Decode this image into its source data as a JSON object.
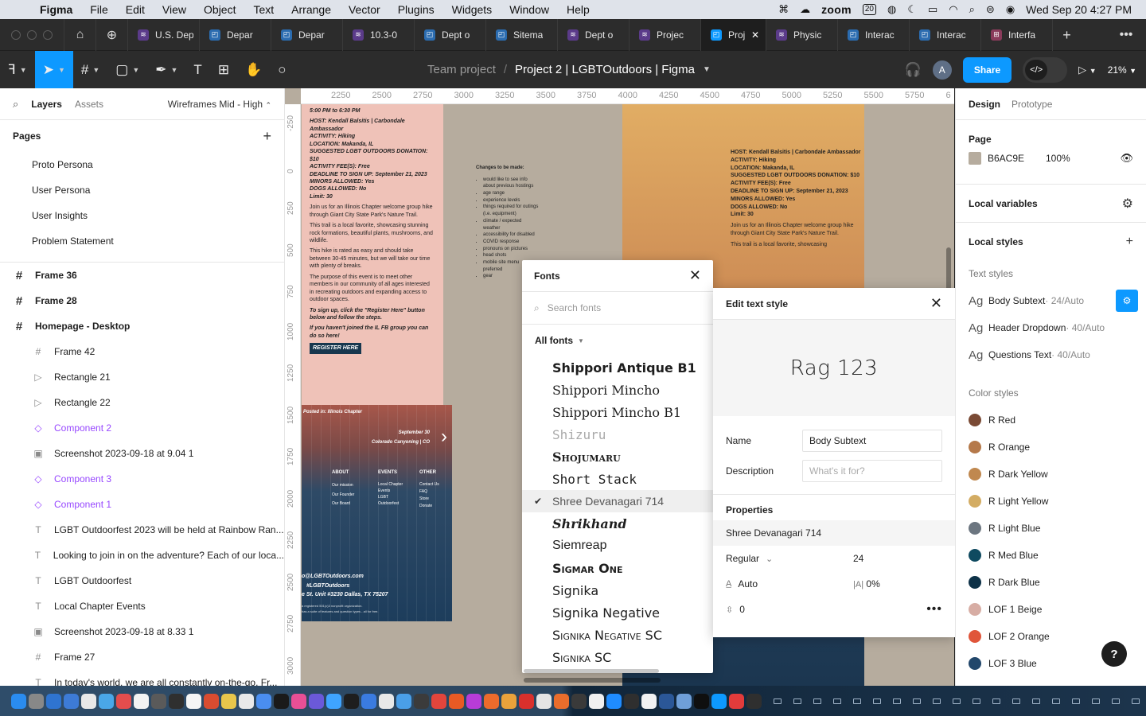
{
  "menubar": {
    "app_name": "Figma",
    "menus": [
      "File",
      "Edit",
      "View",
      "Object",
      "Text",
      "Arrange",
      "Vector",
      "Plugins",
      "Widgets",
      "Window",
      "Help"
    ],
    "zoom_app": "zoom",
    "calendar_day": "20",
    "datetime": "Wed Sep 20  4:27 PM"
  },
  "tabs": [
    {
      "label": "U.S. Dep",
      "color": "#5b3b8a",
      "glyph": "≋"
    },
    {
      "label": "Depar",
      "color": "#2b6cb0",
      "glyph": "◰"
    },
    {
      "label": "Depar",
      "color": "#2b6cb0",
      "glyph": "◰"
    },
    {
      "label": "10.3-0",
      "color": "#5b3b8a",
      "glyph": "≋"
    },
    {
      "label": "Dept o",
      "color": "#2b6cb0",
      "glyph": "◰"
    },
    {
      "label": "Sitema",
      "color": "#2b6cb0",
      "glyph": "◰"
    },
    {
      "label": "Dept o",
      "color": "#5b3b8a",
      "glyph": "≋"
    },
    {
      "label": "Projec",
      "color": "#5b3b8a",
      "glyph": "≋"
    },
    {
      "label": "Proj",
      "color": "#0d99ff",
      "glyph": "◰",
      "active": true
    },
    {
      "label": "Physic",
      "color": "#5b3b8a",
      "glyph": "≋"
    },
    {
      "label": "Interac",
      "color": "#2b6cb0",
      "glyph": "◰"
    },
    {
      "label": "Interac",
      "color": "#2b6cb0",
      "glyph": "◰"
    },
    {
      "label": "Interfa",
      "color": "#8a3b5b",
      "glyph": "⊞"
    }
  ],
  "toolbar": {
    "team": "Team project",
    "separator": "/",
    "project_title": "Project 2 | LGBTOutdoors | Figma",
    "avatar_initial": "A",
    "share_label": "Share",
    "zoom": "21%"
  },
  "left_panel": {
    "layers_tab": "Layers",
    "assets_tab": "Assets",
    "page_selector": "Wireframes Mid - High",
    "pages_heading": "Pages",
    "pages": [
      "Proto Persona",
      "User Persona",
      "User Insights",
      "Problem Statement"
    ],
    "layers": [
      {
        "name": "Frame 36",
        "icon": "#",
        "level": "top"
      },
      {
        "name": "Frame 28",
        "icon": "#",
        "level": "top"
      },
      {
        "name": "Homepage - Desktop",
        "icon": "#",
        "level": "top"
      },
      {
        "name": "Frame 42",
        "icon": "#",
        "level": "child"
      },
      {
        "name": "Rectangle 21",
        "icon": "▷",
        "level": "child"
      },
      {
        "name": "Rectangle 22",
        "icon": "▷",
        "level": "child"
      },
      {
        "name": "Component 2",
        "icon": "◇",
        "level": "child",
        "purple": true
      },
      {
        "name": "Screenshot 2023-09-18 at 9.04 1",
        "icon": "▣",
        "level": "child"
      },
      {
        "name": "Component 3",
        "icon": "◇",
        "level": "child",
        "purple": true
      },
      {
        "name": "Component 1",
        "icon": "◇",
        "level": "child",
        "purple": true
      },
      {
        "name": "LGBT Outdoorfest 2023 will be held at Rainbow Ran...",
        "icon": "T",
        "level": "child"
      },
      {
        "name": "Looking to join in on the adventure? Each of our loca...",
        "icon": "T",
        "level": "child"
      },
      {
        "name": "LGBT Outdoorfest",
        "icon": "T",
        "level": "child"
      },
      {
        "name": "Local Chapter Events",
        "icon": "T",
        "level": "child"
      },
      {
        "name": "Screenshot 2023-09-18 at 8.33 1",
        "icon": "▣",
        "level": "child"
      },
      {
        "name": "Frame 27",
        "icon": "#",
        "level": "child"
      },
      {
        "name": "In today's world, we are all constantly on-the-go. Fr...",
        "icon": "T",
        "level": "child"
      }
    ]
  },
  "canvas": {
    "ruler_x": [
      "2250",
      "2500",
      "2750",
      "3000",
      "3250",
      "3500",
      "3750",
      "4000",
      "4250",
      "4500",
      "4750",
      "5000",
      "5250",
      "5500",
      "5750",
      "6"
    ],
    "ruler_y": [
      "-250",
      "0",
      "250",
      "500",
      "750",
      "1000",
      "1250",
      "1500",
      "1750",
      "2000",
      "2250",
      "2500",
      "2750",
      "3000"
    ],
    "pink_frame": {
      "time": "5:00 PM to 6:30 PM",
      "host": "HOST: Kendall Balsitis | Carbondale Ambassador",
      "activity": "ACTIVITY: Hiking",
      "location": "LOCATION: Makanda, IL",
      "donation": "SUGGESTED LGBT OUTDOORS DONATION: $10",
      "fee": "ACTIVITY FEE(S): Free",
      "deadline": "DEADLINE TO SIGN UP: September 21, 2023",
      "minors": "MINORS ALLOWED: Yes",
      "dogs": "DOGS ALLOWED: No",
      "limit": "Limit: 30",
      "p1": "Join us for an Illinois Chapter welcome group hike through Giant City State Park's Nature Trail.",
      "p2": "This trail is a local favorite, showcasing stunning rock formations, beautiful plants, mushrooms, and wildlife.",
      "p3": "This hike is rated as easy and should take between 30-45 minutes, but we will take our time with plenty of breaks.",
      "p4": "The purpose of this event is to meet other members in our community of all ages interested in recreating outdoors and expanding access to outdoor spaces.",
      "p5": "To sign up, click the \"Register Here\" button below and follow the steps.",
      "p6": "If you haven't joined the IL FB group you can do so here!",
      "register": "REGISTER HERE"
    },
    "sunset_frame": {
      "posted": "Posted in: Illinois Chapter",
      "date": "September 30",
      "event": "Colorado Canyoning | CO",
      "col_about": "ABOUT",
      "col_events": "EVENTS",
      "col_other": "OTHER",
      "about_items": "Our mission\nOur Founder\nOur Board",
      "events_items": "Local Chapter Events\nLGBT Outdoorfest",
      "other_items": "Contact Us\nFAQ\nStore\nDonate",
      "email": "o@LGBTOutdoors.com",
      "hashtag": "#LGBTOutdoors",
      "address": "e St. Unit #3230 Dallas, TX 75207",
      "legal1": "a registered 501(c)3 nonprofit organization.",
      "legal2": "has a suite of features and question types - all for free."
    },
    "changes": {
      "title": "Changes to be made:",
      "items": [
        "would like to see info about previous hostings",
        "age range",
        "experience levels",
        "things required for outings (i.e. equipment)",
        "climate / expected weather",
        "accessibility for disabled",
        "COVID response",
        "pronouns on pictures",
        "head shots",
        "mobile site menu preferred",
        "gear"
      ]
    },
    "gold_frame": {
      "host": "HOST: Kendall Balsitis | Carbondale Ambassador",
      "activity": "ACTIVITY: Hiking",
      "location": "LOCATION: Makanda, IL",
      "donation": "SUGGESTED LGBT OUTDOORS DONATION: $10",
      "fee": "ACTIVITY FEE(S): Free",
      "deadline": "DEADLINE TO SIGN UP: September 21, 2023",
      "minors": "MINORS ALLOWED: Yes",
      "dogs": "DOGS ALLOWED: No",
      "limit": "Limit: 30",
      "p1": "Join us for an Illinois Chapter welcome group hike through Giant City State Park's Nature Trail.",
      "p2": "This trail is a local favorite, showcasing"
    }
  },
  "fonts_popup": {
    "title": "Fonts",
    "search_placeholder": "Search fonts",
    "filter": "All fonts",
    "fonts": [
      {
        "name": "Shippori Antique B1",
        "family": "\"DejaVu Sans\", sans-serif",
        "weight": "600",
        "style": "normal"
      },
      {
        "name": "Shippori Mincho",
        "family": "\"DejaVu Serif\", serif",
        "weight": "normal",
        "style": "normal"
      },
      {
        "name": "Shippori Mincho B1",
        "family": "\"DejaVu Serif\", serif",
        "weight": "normal",
        "style": "normal"
      },
      {
        "name": "Shizuru",
        "family": "\"DejaVu Sans Mono\", monospace",
        "weight": "normal",
        "style": "normal",
        "muted": true
      },
      {
        "name": "Shojumaru",
        "family": "\"DejaVu Serif\", serif",
        "weight": "bold",
        "style": "normal",
        "caps": true
      },
      {
        "name": "Short Stack",
        "family": "\"DejaVu Sans Mono\", monospace",
        "weight": "normal",
        "style": "normal"
      },
      {
        "name": "Shree Devanagari 714",
        "family": "\"Liberation Sans\", sans-serif",
        "weight": "normal",
        "style": "normal",
        "selected": true
      },
      {
        "name": "Shrikhand",
        "family": "\"DejaVu Serif\", serif",
        "weight": "bold",
        "style": "italic"
      },
      {
        "name": "Siemreap",
        "family": "\"Liberation Sans\", sans-serif",
        "weight": "normal",
        "style": "normal"
      },
      {
        "name": "Sigmar One",
        "family": "\"DejaVu Sans\", sans-serif",
        "weight": "bold",
        "style": "normal",
        "caps": true
      },
      {
        "name": "Signika",
        "family": "\"DejaVu Sans\", sans-serif",
        "weight": "normal",
        "style": "normal"
      },
      {
        "name": "Signika Negative",
        "family": "\"DejaVu Sans\", sans-serif",
        "weight": "normal",
        "style": "normal"
      },
      {
        "name": "Signika Negative SC",
        "family": "\"DejaVu Sans\", sans-serif",
        "weight": "normal",
        "style": "normal",
        "caps": true
      },
      {
        "name": "Signika SC",
        "family": "\"DejaVu Sans\", sans-serif",
        "weight": "normal",
        "style": "normal",
        "caps": true
      }
    ]
  },
  "edit_text_style": {
    "title": "Edit text style",
    "preview": "Rag 123",
    "name_label": "Name",
    "name_value": "Body Subtext",
    "description_label": "Description",
    "description_placeholder": "What's it for?",
    "properties_label": "Properties",
    "font_family": "Shree Devanagari 714",
    "weight": "Regular",
    "size": "24",
    "line_height": "Auto",
    "letter_spacing": "0%",
    "paragraph_spacing": "0"
  },
  "right_panel": {
    "design_tab": "Design",
    "prototype_tab": "Prototype",
    "page_heading": "Page",
    "page_color_hex": "B6AC9E",
    "page_color_opacity": "100%",
    "page_color": "#b6ac9e",
    "local_variables": "Local variables",
    "local_styles": "Local styles",
    "text_styles_heading": "Text styles",
    "text_styles": [
      {
        "name": "Body Subtext",
        "meta": " · 24/Auto",
        "editing": true
      },
      {
        "name": "Header Dropdown",
        "meta": " · 40/Auto"
      },
      {
        "name": "Questions Text",
        "meta": " · 40/Auto"
      }
    ],
    "color_styles_heading": "Color styles",
    "color_styles": [
      {
        "name": "R Red",
        "color": "#7a4a35"
      },
      {
        "name": "R Orange",
        "color": "#b5794a"
      },
      {
        "name": "R Dark Yellow",
        "color": "#c0884f"
      },
      {
        "name": "R Light Yellow",
        "color": "#d3ac63"
      },
      {
        "name": "R Light Blue",
        "color": "#6c7680"
      },
      {
        "name": "R Med Blue",
        "color": "#0f4a60"
      },
      {
        "name": "R Dark Blue",
        "color": "#0e3248"
      },
      {
        "name": "LOF 1 Beige",
        "color": "#d7ada4"
      },
      {
        "name": "LOF 2 Orange",
        "color": "#e0553a"
      },
      {
        "name": "LOF 3 Blue",
        "color": "#22476b"
      }
    ]
  },
  "help_label": "?",
  "dock_apps": [
    "#2a8cf0",
    "#888888",
    "#2f74d0",
    "#3d7bd6",
    "#e8e8e8",
    "#4aa7e8",
    "#e34d4d",
    "#f2f2f2",
    "#5a5a5a",
    "#2f2f2f",
    "#f5f5f5",
    "#d94c30",
    "#e8c64b",
    "#e9e9e9",
    "#4a8ef0",
    "#1a1a1a",
    "#e84f95",
    "#6b59d8",
    "#3fa4ff",
    "#1e1e1e",
    "#3a7be0",
    "#e8e8e8",
    "#4a9fe8",
    "#3b3b3b",
    "#e2453c",
    "#e85a24",
    "#b73cd8",
    "#ec6b2c",
    "#e9a23b",
    "#d9302c",
    "#e4e4e4",
    "#e96d2c",
    "#3a3a3a",
    "#f0f0f0",
    "#1f8cff",
    "#2f2f2f",
    "#f2f2f2",
    "#2b5797",
    "#6f9fd8",
    "#0f0f0f",
    "#0d99ff",
    "#e23b3b",
    "#2f2f2f"
  ]
}
